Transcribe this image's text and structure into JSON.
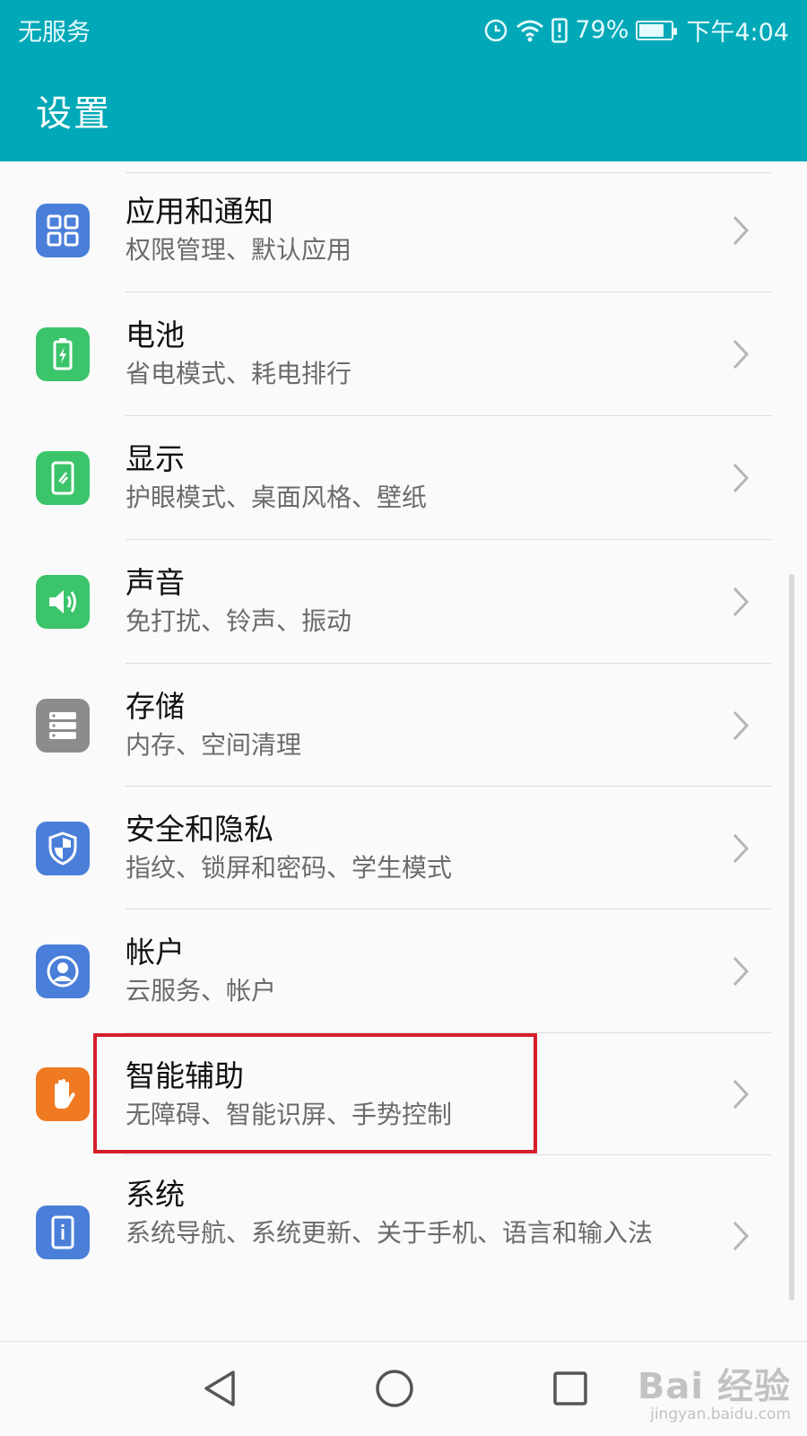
{
  "status_bar": {
    "carrier": "无服务",
    "battery_percent": "79%",
    "battery_level": 0.79,
    "time": "下午4:04",
    "icons": [
      "alarm-icon",
      "wifi-icon",
      "alert-icon",
      "battery-icon"
    ]
  },
  "app_bar": {
    "title": "设置"
  },
  "settings": [
    {
      "title": "应用和通知",
      "subtitle": "权限管理、默认应用",
      "icon": "apps-grid-icon",
      "color": "#4a7fd9"
    },
    {
      "title": "电池",
      "subtitle": "省电模式、耗电排行",
      "icon": "battery-charging-icon",
      "color": "#3bc46a"
    },
    {
      "title": "显示",
      "subtitle": "护眼模式、桌面风格、壁纸",
      "icon": "display-icon",
      "color": "#3bc46a"
    },
    {
      "title": "声音",
      "subtitle": "免打扰、铃声、振动",
      "icon": "speaker-icon",
      "color": "#3bc46a"
    },
    {
      "title": "存储",
      "subtitle": "内存、空间清理",
      "icon": "storage-icon",
      "color": "#8c8c8c"
    },
    {
      "title": "安全和隐私",
      "subtitle": "指纹、锁屏和密码、学生模式",
      "icon": "shield-icon",
      "color": "#4a7fd9"
    },
    {
      "title": "帐户",
      "subtitle": "云服务、帐户",
      "icon": "account-icon",
      "color": "#4a7fd9"
    },
    {
      "title": "智能辅助",
      "subtitle": "无障碍、智能识屏、手势控制",
      "icon": "hand-icon",
      "color": "#f07a22"
    },
    {
      "title": "系统",
      "subtitle": "系统导航、系统更新、关于手机、语言和输入法",
      "icon": "system-info-icon",
      "color": "#4a7fd9"
    }
  ],
  "nav_bar": {
    "buttons": [
      "back-icon",
      "home-icon",
      "recents-icon"
    ]
  },
  "watermark": {
    "main": "Bai 经验",
    "sub": "jingyan.baidu.com"
  },
  "colors": {
    "accent": "#00a8b8",
    "highlight_border": "#d51f2b"
  }
}
